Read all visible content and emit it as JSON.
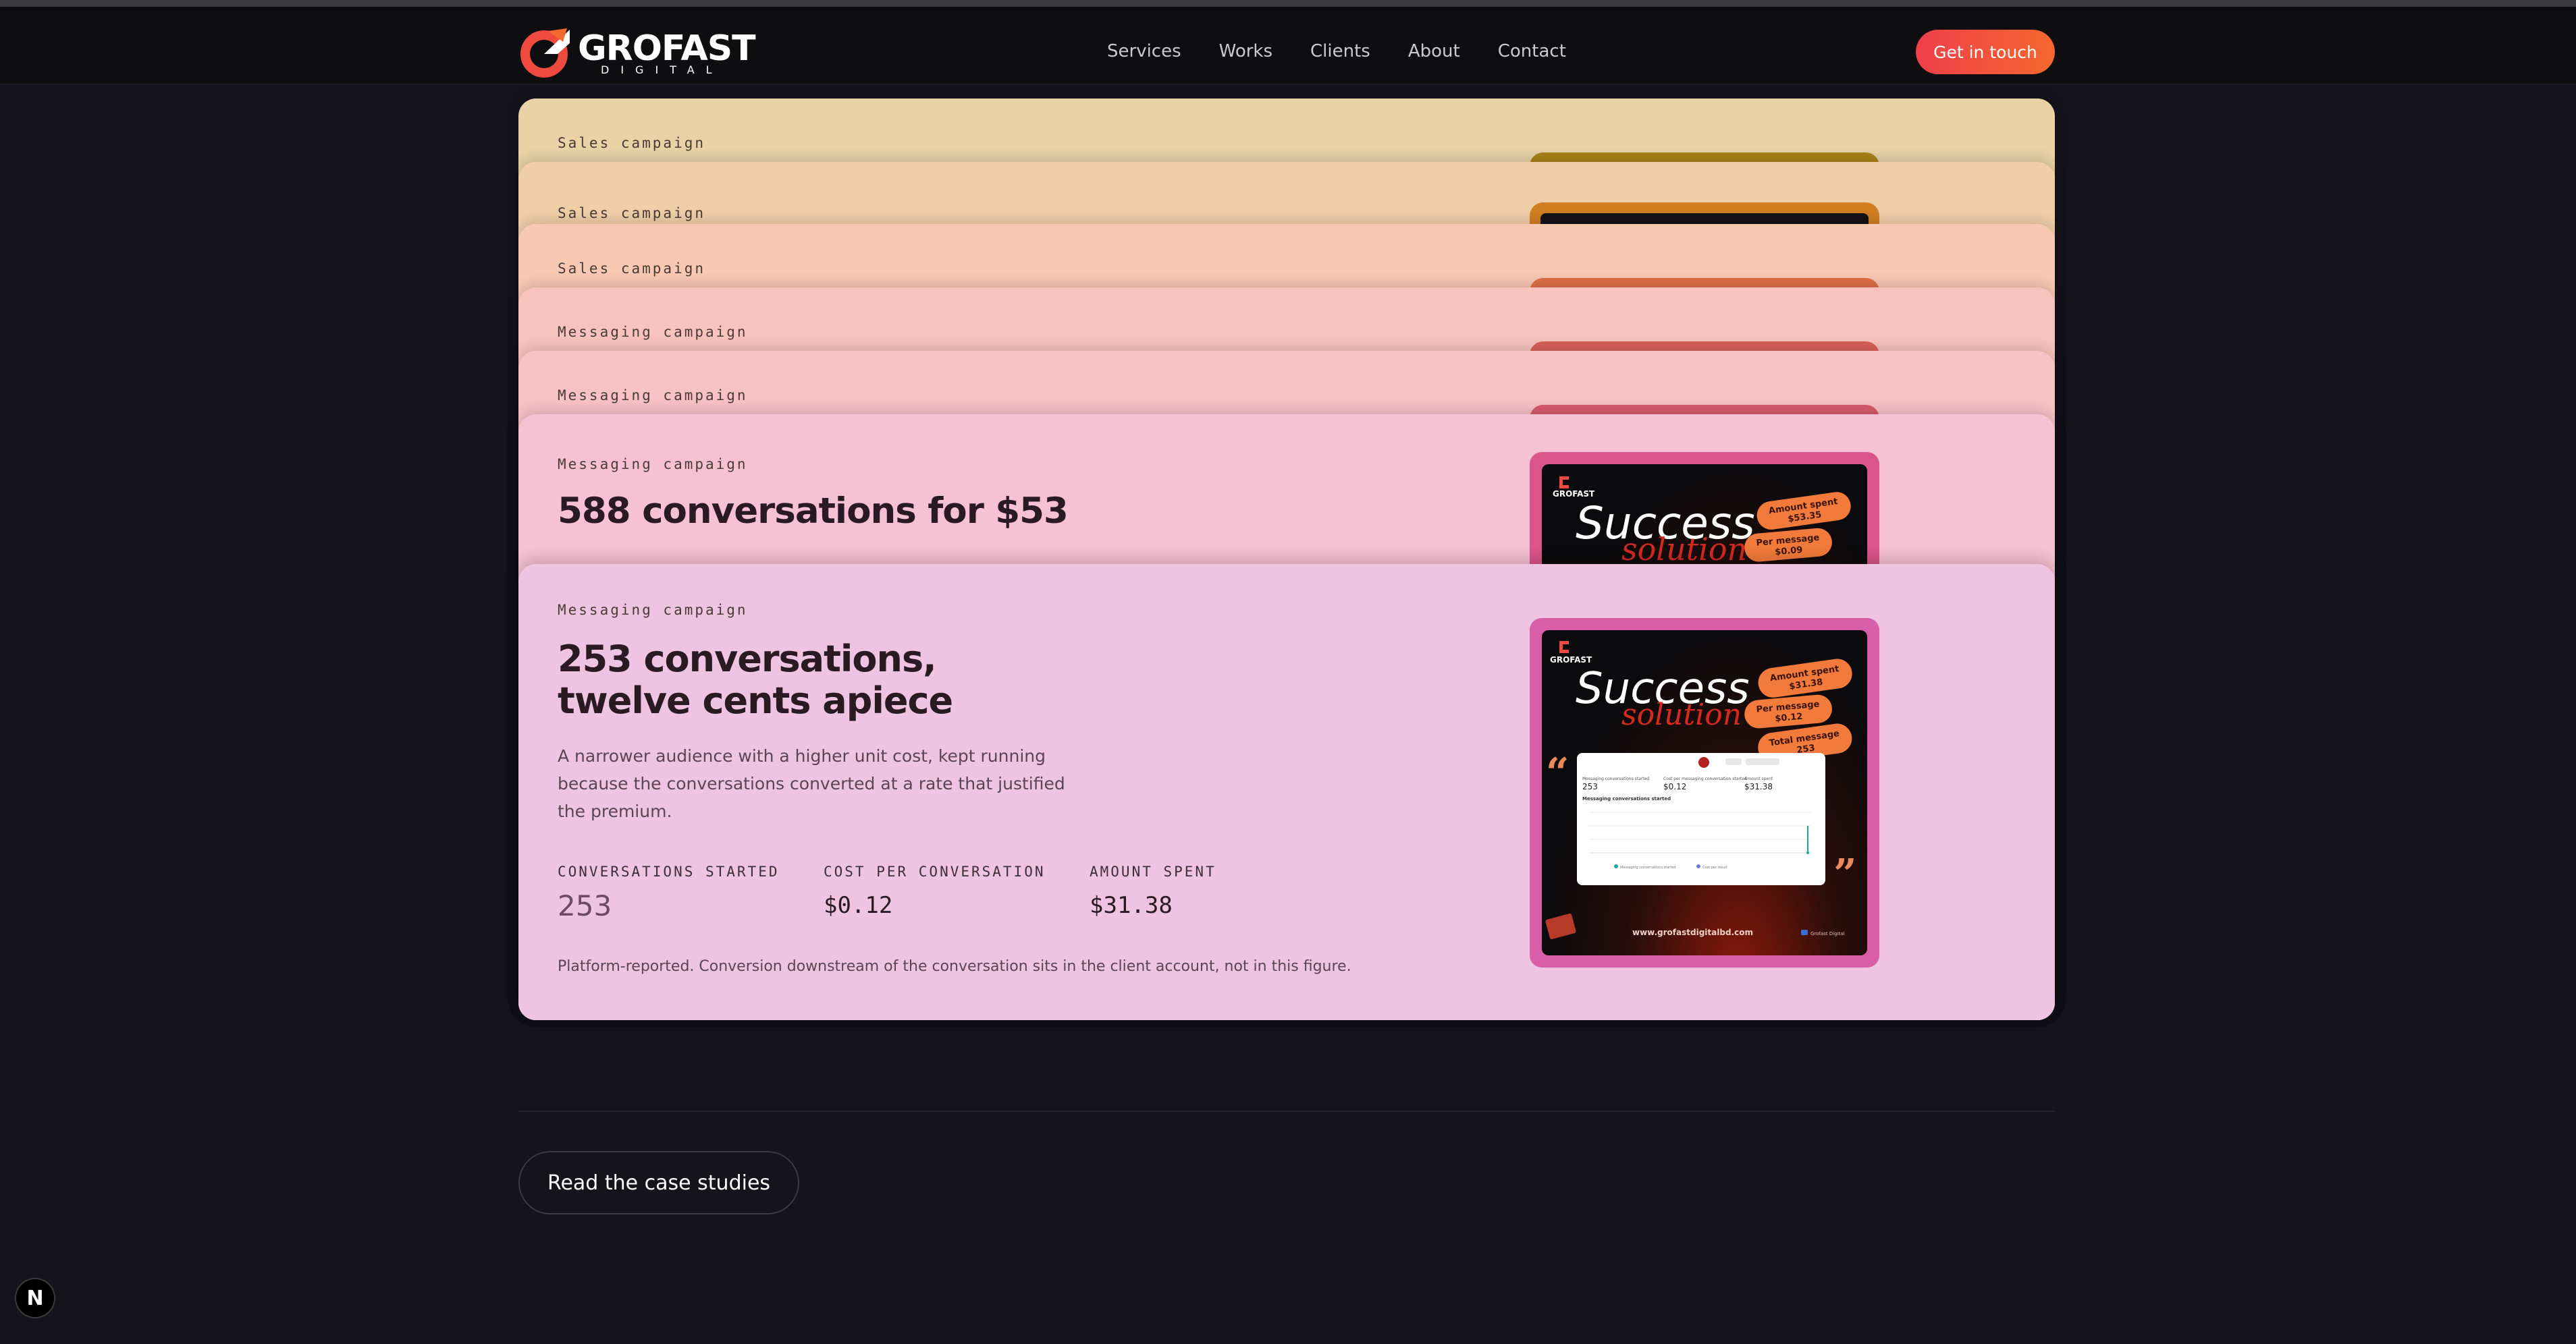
{
  "brand": {
    "name": "GROFAST",
    "sub": "DIGITAL"
  },
  "nav": {
    "links": [
      "Services",
      "Works",
      "Clients",
      "About",
      "Contact"
    ],
    "cta": "Get in touch"
  },
  "cards": [
    {
      "tag": "Sales campaign",
      "color": "#e8d2a6",
      "thumb": "#a8821a"
    },
    {
      "tag": "Sales campaign",
      "color": "#f0cea8",
      "thumb": "#d27f22"
    },
    {
      "tag": "Sales campaign",
      "color": "#f8c8b2",
      "thumb": "#e0704a"
    },
    {
      "tag": "Messaging campaign",
      "color": "#f9c3bd",
      "thumb": "#d9615a"
    },
    {
      "tag": "Messaging campaign",
      "color": "#f8c1c6",
      "thumb": "#d85a6c"
    },
    {
      "tag": "Messaging campaign",
      "headline": "588 conversations for $53",
      "color": "#f6c1d3",
      "thumb": "#d9558a",
      "promo": {
        "title": "Success",
        "script": "solution",
        "brand": "GROFAST",
        "pills": [
          {
            "label": "Amount spent",
            "value": "$53.35"
          },
          {
            "label": "Per message",
            "value": "$0.09"
          }
        ]
      }
    },
    {
      "tag": "Messaging campaign",
      "headline_1": "253 conversations,",
      "headline_2": "twelve cents apiece",
      "description": "A narrower audience with a higher unit cost, kept running because the conversations converted at a rate that justified the premium.",
      "color": "#efc4e2",
      "thumb": "#d95ea8",
      "stats": [
        {
          "label": "CONVERSATIONS STARTED",
          "value": "253"
        },
        {
          "label": "COST PER CONVERSATION",
          "value": "$0.12"
        },
        {
          "label": "AMOUNT SPENT",
          "value": "$31.38"
        }
      ],
      "note": "Platform-reported. Conversion downstream of the conversation sits in the client account, not in this figure.",
      "promo": {
        "title": "Success",
        "script": "solution",
        "brand": "GROFAST",
        "pills": [
          {
            "label": "Amount spent",
            "value": "$31.38"
          },
          {
            "label": "Per message",
            "value": "$0.12"
          },
          {
            "label": "Total message",
            "value": "253"
          }
        ],
        "dashboard": {
          "stats": [
            {
              "label": "Messaging conversations started",
              "value": "253"
            },
            {
              "label": "Cost per messaging conversation started",
              "value": "$0.12"
            },
            {
              "label": "Amount spent",
              "value": "$31.38"
            }
          ],
          "chart_title": "Messaging conversations started",
          "legend": [
            "Messaging conversations started",
            "Cost per result"
          ]
        },
        "url": "www.grofastdigitalbd.com",
        "footer_brand": "Grofast Digital"
      }
    }
  ],
  "footer": {
    "button": "Read the case studies",
    "badge": "N"
  }
}
